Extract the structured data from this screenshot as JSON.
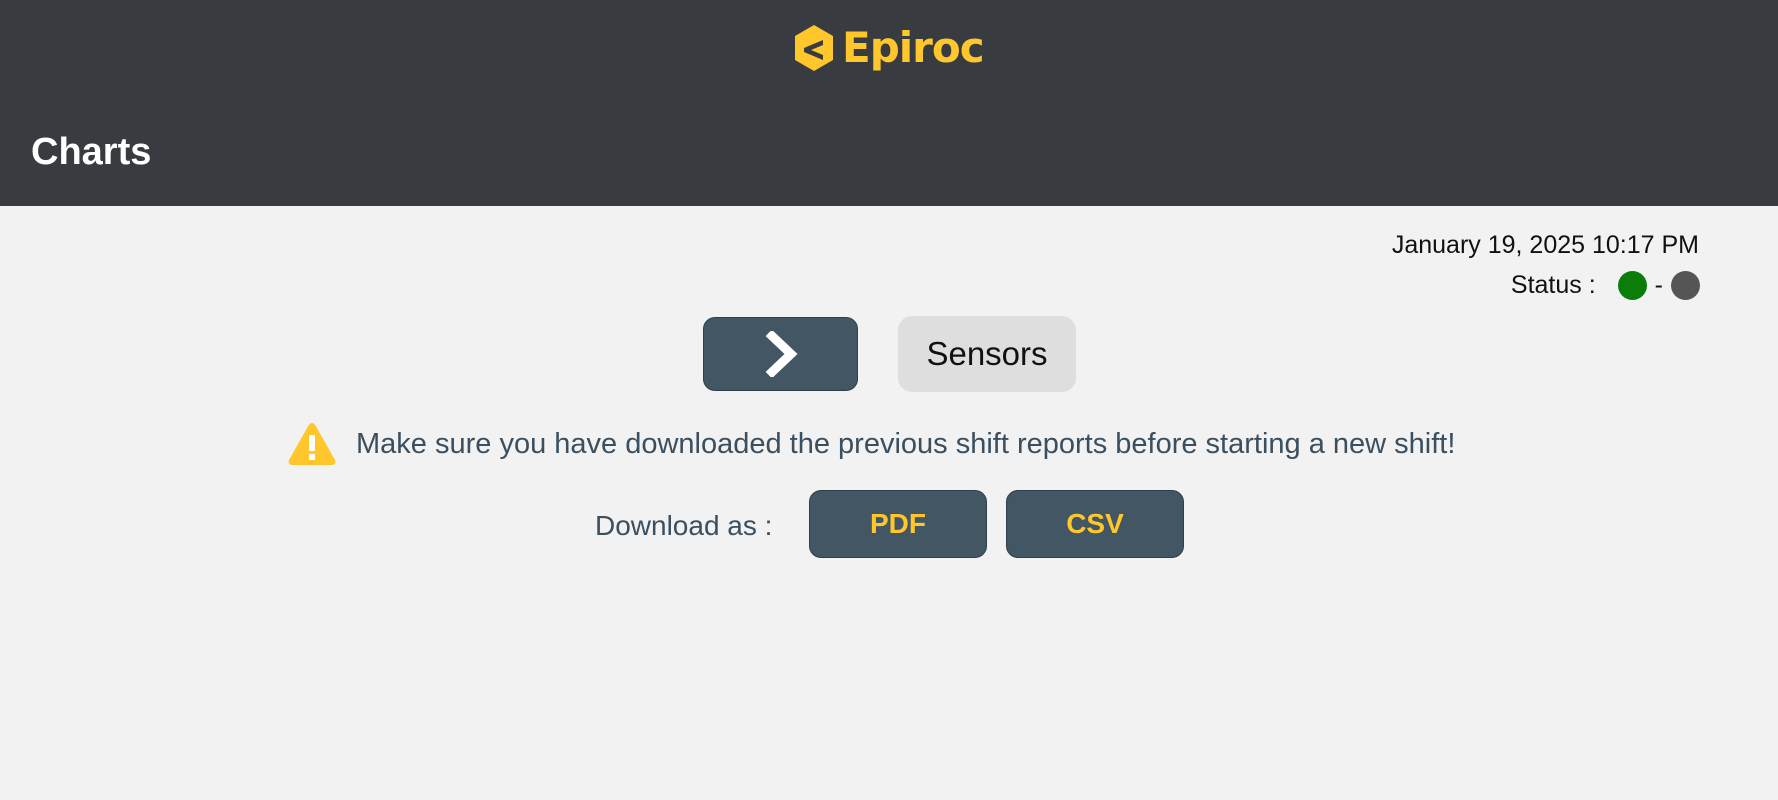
{
  "header": {
    "logo_text": "Epiroc",
    "title": "Charts"
  },
  "status_bar": {
    "datetime": "January 19, 2025 10:17 PM",
    "status_label": "Status :",
    "separator": "-",
    "indicator_1_color": "#0a7d0a",
    "indicator_2_color": "#555555"
  },
  "navigation": {
    "next_icon": "chevron-right-icon",
    "sensors_label": "Sensors"
  },
  "warning": {
    "icon": "warning-icon",
    "message": "Make sure you have downloaded the previous shift reports before starting a new shift!"
  },
  "download": {
    "label": "Download as :",
    "pdf_label": "PDF",
    "csv_label": "CSV"
  },
  "colors": {
    "brand_yellow": "#ffc72c",
    "header_bg": "#383c41",
    "button_bg": "#425664",
    "page_bg": "#f2f2f2"
  }
}
